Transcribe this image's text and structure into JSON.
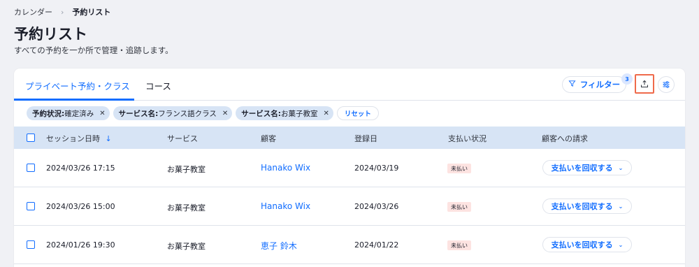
{
  "breadcrumb": {
    "parent": "カレンダー",
    "separator": "›",
    "current": "予約リスト"
  },
  "page": {
    "title": "予約リスト",
    "subtitle": "すべての予約を一か所で管理・追跡します。"
  },
  "tabs": [
    {
      "label": "プライベート予約・クラス",
      "active": true
    },
    {
      "label": "コース",
      "active": false
    }
  ],
  "toolbar": {
    "filter_label": "フィルター",
    "filter_count": "3"
  },
  "filters": [
    {
      "key": "予約状況:",
      "value": "確定済み"
    },
    {
      "key": "サービス名:",
      "value": "フランス語クラス"
    },
    {
      "key": "サービス名:",
      "value": "お菓子教室"
    }
  ],
  "reset_label": "リセット",
  "table": {
    "columns": {
      "session": "セッション日時",
      "sort_indicator": "↓",
      "service": "サービス",
      "customer": "顧客",
      "registered": "登録日",
      "payment": "支払い状況",
      "charge": "顧客への請求"
    },
    "rows": [
      {
        "session": "2024/03/26 17:15",
        "service": "お菓子教室",
        "customer": "Hanako Wix",
        "registered": "2024/03/19",
        "payment": "未払い",
        "action": "支払いを回収する"
      },
      {
        "session": "2024/03/26 15:00",
        "service": "お菓子教室",
        "customer": "Hanako Wix",
        "registered": "2024/03/26",
        "payment": "未払い",
        "action": "支払いを回収する"
      },
      {
        "session": "2024/01/26 19:30",
        "service": "お菓子教室",
        "customer": "恵子 鈴木",
        "registered": "2024/01/22",
        "payment": "未払い",
        "action": "支払いを回収する"
      }
    ]
  },
  "colors": {
    "accent": "#116dff",
    "header_bg": "#d7e4f5",
    "unpaid_bg": "#fde3e1",
    "highlight": "#ef6a4b"
  },
  "icons": {
    "filter": "funnel-icon",
    "export": "upload-icon",
    "settings": "sliders-icon",
    "close": "close-icon",
    "chevron": "chevron-down-icon"
  }
}
